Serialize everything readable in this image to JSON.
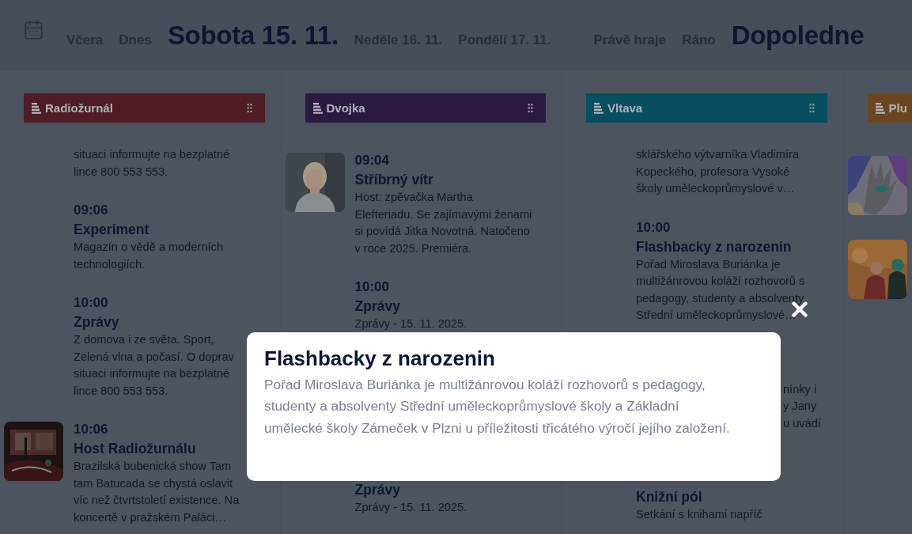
{
  "date_tabs": [
    {
      "label": "Včera",
      "selected": false
    },
    {
      "label": "Dnes",
      "selected": false
    },
    {
      "label": "Sobota 15. 11.",
      "selected": true
    },
    {
      "label": "Neděle 16. 11.",
      "selected": false
    },
    {
      "label": "Pondělí 17. 11.",
      "selected": false
    }
  ],
  "time_tabs": [
    {
      "label": "Právě hraje",
      "selected": false
    },
    {
      "label": "Ráno",
      "selected": false
    },
    {
      "label": "Dopoledne",
      "selected": true
    }
  ],
  "channels": [
    {
      "name": "Radiožurnál",
      "color": "#4f1b25",
      "programs": [
        {
          "kind": "continued",
          "lines": [
            "situaci informujte na bezplatné",
            "lince 800 553 553."
          ]
        },
        {
          "kind": "program",
          "time": "09:06",
          "title": "Experiment",
          "lines": [
            "Magazín o vědě a moderních",
            "technologiích."
          ]
        },
        {
          "kind": "program",
          "time": "10:00",
          "title": "Zprávy",
          "lines": [
            "Z domova i ze světa. Sport,",
            "Zelená vlna a počasí. O doprav",
            "situaci informujte na bezplatné",
            "lince 800 553 553."
          ]
        },
        {
          "kind": "program",
          "time": "10:06",
          "title": "Host Radiožurnálu",
          "thumbnail": {
            "kind": "studio"
          },
          "lines": [
            "Brazilská bubenická show Tam",
            "tam Batucada se chystá oslavit",
            "víc než čtvrtstoletí existence. Na",
            "koncertě v pražském Paláci…"
          ]
        }
      ]
    },
    {
      "name": "Dvojka",
      "color": "#2c1941",
      "programs": [
        {
          "kind": "program",
          "time": "09:04",
          "title": "Stříbrný vítr",
          "thumbnail": {
            "kind": "portrait"
          },
          "lines": [
            "Host: zpěvačka Martha",
            "Elefteriadu. Se zajímavými ženami",
            "si povídá Jitka Novotná. Natočeno",
            "v roce 2025. Premiéra."
          ]
        },
        {
          "kind": "program",
          "time": "10:00",
          "title": "Zprávy",
          "lines": [
            "Zprávy - 15. 11. 2025."
          ]
        },
        {
          "kind": "continued",
          "title": "Zprávy",
          "lines": [
            "Zprávy - 15. 11. 2025."
          ]
        }
      ]
    },
    {
      "name": "Vltava",
      "color": "#074f5f",
      "programs": [
        {
          "kind": "continued",
          "lines": [
            "sklářského výtvarníka Vladimíra",
            "Kopeckého, profesora Vysoké",
            "školy uměleckoprůmyslové v…"
          ]
        },
        {
          "kind": "program",
          "time": "10:00",
          "title": "Flashbacky z narozenin",
          "lines": [
            "Pořad Miroslava Buriánka je",
            "multižánrovou koláží rozhovorů s",
            "pedagogy, studenty a absolventy",
            "Střední uměleckoprůmyslové…"
          ]
        },
        {
          "kind": "clipped",
          "lines": [
            "nínky i",
            "y Jany",
            "u uvádí"
          ]
        },
        {
          "kind": "continued",
          "title": "Knižní pól",
          "lines": [
            "Setkání s knihami napříč"
          ]
        }
      ]
    },
    {
      "name": "Plu",
      "color": "#6b4520",
      "programs": [
        {
          "thumbnail": {
            "kind": "hand"
          }
        },
        {
          "thumbnail": {
            "kind": "crowd"
          }
        }
      ]
    }
  ],
  "modal": {
    "title": "Flashbacky z narozenin",
    "text": "Pořad Miroslava Buriánka je multižánrovou koláží rozhovorů s pedagogy, studenty a absolventy Střední uměleckoprůmyslové školy a Základní umělecké školy Zámeček v Plzni u příležitosti třicátého výročí jejího založení."
  }
}
